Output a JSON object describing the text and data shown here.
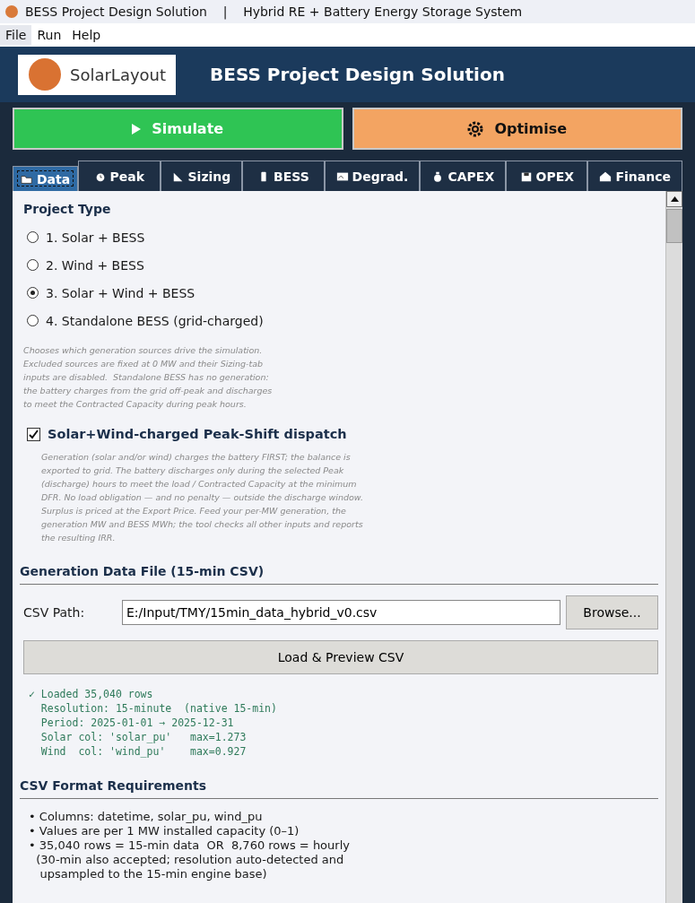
{
  "window": {
    "title": "BESS Project Design Solution    |    Hybrid RE + Battery Energy Storage System"
  },
  "menu": [
    {
      "label": "File",
      "selected": true
    },
    {
      "label": "Run",
      "selected": false
    },
    {
      "label": "Help",
      "selected": false
    }
  ],
  "header": {
    "logo_text": "SolarLayout",
    "title": "BESS Project Design Solution"
  },
  "actions": [
    {
      "label": "Simulate",
      "kind": "play",
      "color": "#2fc454"
    },
    {
      "label": "Optimise",
      "kind": "gear",
      "color": "#f3a462"
    }
  ],
  "tabs": [
    {
      "label": "Data",
      "selected": true
    },
    {
      "label": "Peak",
      "selected": false
    },
    {
      "label": "Sizing",
      "selected": false
    },
    {
      "label": "BESS",
      "selected": false
    },
    {
      "label": "Degrad.",
      "selected": false
    },
    {
      "label": "CAPEX",
      "selected": false
    },
    {
      "label": "OPEX",
      "selected": false
    },
    {
      "label": "Finance",
      "selected": false
    }
  ],
  "project_type": {
    "heading": "Project Type",
    "options": [
      {
        "label": "1.  Solar + BESS",
        "selected": false
      },
      {
        "label": "2.  Wind + BESS",
        "selected": false
      },
      {
        "label": "3.  Solar + Wind + BESS",
        "selected": true
      },
      {
        "label": "4.  Standalone BESS (grid-charged)",
        "selected": false
      }
    ],
    "note": "Chooses which generation sources drive the simulation.\nExcluded sources are fixed at 0 MW and their Sizing-tab\ninputs are disabled.  Standalone BESS has no generation:\nthe battery charges from the grid off-peak and discharges\nto meet the Contracted Capacity during peak hours."
  },
  "dispatch": {
    "label": "Solar+Wind-charged Peak-Shift dispatch",
    "checked": true,
    "note": "Generation (solar and/or wind) charges the battery FIRST; the balance is\nexported to grid. The battery discharges only during the selected Peak\n(discharge) hours to meet the load / Contracted Capacity at the minimum\nDFR. No load obligation — and no penalty — outside the discharge window.\nSurplus is priced at the Export Price. Feed your per-MW generation, the\ngeneration MW and BESS MWh; the tool checks all other inputs and reports\nthe resulting IRR."
  },
  "generation_file": {
    "heading": "Generation Data File (15-min CSV)",
    "path_label": "CSV Path:",
    "path_value": "E:/Input/TMY/15min_data_hybrid_v0.csv",
    "browse": "Browse...",
    "load": "Load & Preview CSV",
    "log": "✓ Loaded 35,040 rows\n  Resolution: 15-minute  (native 15-min)\n  Period: 2025-01-01 → 2025-12-31\n  Solar col: 'solar_pu'   max=1.273\n  Wind  col: 'wind_pu'    max=0.927"
  },
  "requirements": {
    "heading": "CSV Format Requirements",
    "items": [
      "• Columns: datetime, solar_pu, wind_pu",
      "• Values are per 1 MW installed capacity (0–1)",
      "• 35,040 rows = 15-min data  OR  8,760 rows = hourly\n  (30-min also accepted; resolution auto-detected and\n   upsampled to the 15-min engine base)"
    ]
  }
}
